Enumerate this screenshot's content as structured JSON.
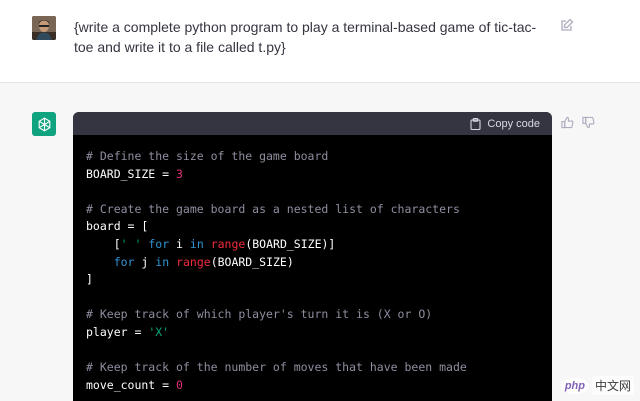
{
  "user_message": {
    "text": "{write a complete python program to play a terminal-based game of tic-tac-toe and write it to a file called t.py}"
  },
  "assistant_message": {
    "copy_label": "Copy code",
    "code_lines": [
      [
        {
          "t": "# Define the size of the game board",
          "c": "comment"
        }
      ],
      [
        {
          "t": "BOARD_SIZE = ",
          "c": "plain"
        },
        {
          "t": "3",
          "c": "num"
        }
      ],
      [],
      [
        {
          "t": "# Create the game board as a nested list of characters",
          "c": "comment"
        }
      ],
      [
        {
          "t": "board = [",
          "c": "plain"
        }
      ],
      [
        {
          "t": "    [",
          "c": "plain"
        },
        {
          "t": "' '",
          "c": "str"
        },
        {
          "t": " ",
          "c": "plain"
        },
        {
          "t": "for",
          "c": "kw"
        },
        {
          "t": " i ",
          "c": "plain"
        },
        {
          "t": "in",
          "c": "kw"
        },
        {
          "t": " ",
          "c": "plain"
        },
        {
          "t": "range",
          "c": "fn"
        },
        {
          "t": "(BOARD_SIZE)]",
          "c": "plain"
        }
      ],
      [
        {
          "t": "    ",
          "c": "plain"
        },
        {
          "t": "for",
          "c": "kw"
        },
        {
          "t": " j ",
          "c": "plain"
        },
        {
          "t": "in",
          "c": "kw"
        },
        {
          "t": " ",
          "c": "plain"
        },
        {
          "t": "range",
          "c": "fn"
        },
        {
          "t": "(BOARD_SIZE)",
          "c": "plain"
        }
      ],
      [
        {
          "t": "]",
          "c": "plain"
        }
      ],
      [],
      [
        {
          "t": "# Keep track of which player's turn it is (X or O)",
          "c": "comment"
        }
      ],
      [
        {
          "t": "player = ",
          "c": "plain"
        },
        {
          "t": "'X'",
          "c": "str"
        }
      ],
      [],
      [
        {
          "t": "# Keep track of the number of moves that have been made",
          "c": "comment"
        }
      ],
      [
        {
          "t": "move_count = ",
          "c": "plain"
        },
        {
          "t": "0",
          "c": "num"
        }
      ]
    ]
  },
  "watermark": {
    "logo": "php",
    "text": "中文网"
  },
  "colors": {
    "gpt_green": "#10a37f",
    "code_bg": "#000000",
    "header_bg": "#343541"
  },
  "icons": [
    "user-avatar",
    "edit-icon",
    "openai-logo-icon",
    "clipboard-icon",
    "thumbs-up-icon",
    "thumbs-down-icon"
  ]
}
